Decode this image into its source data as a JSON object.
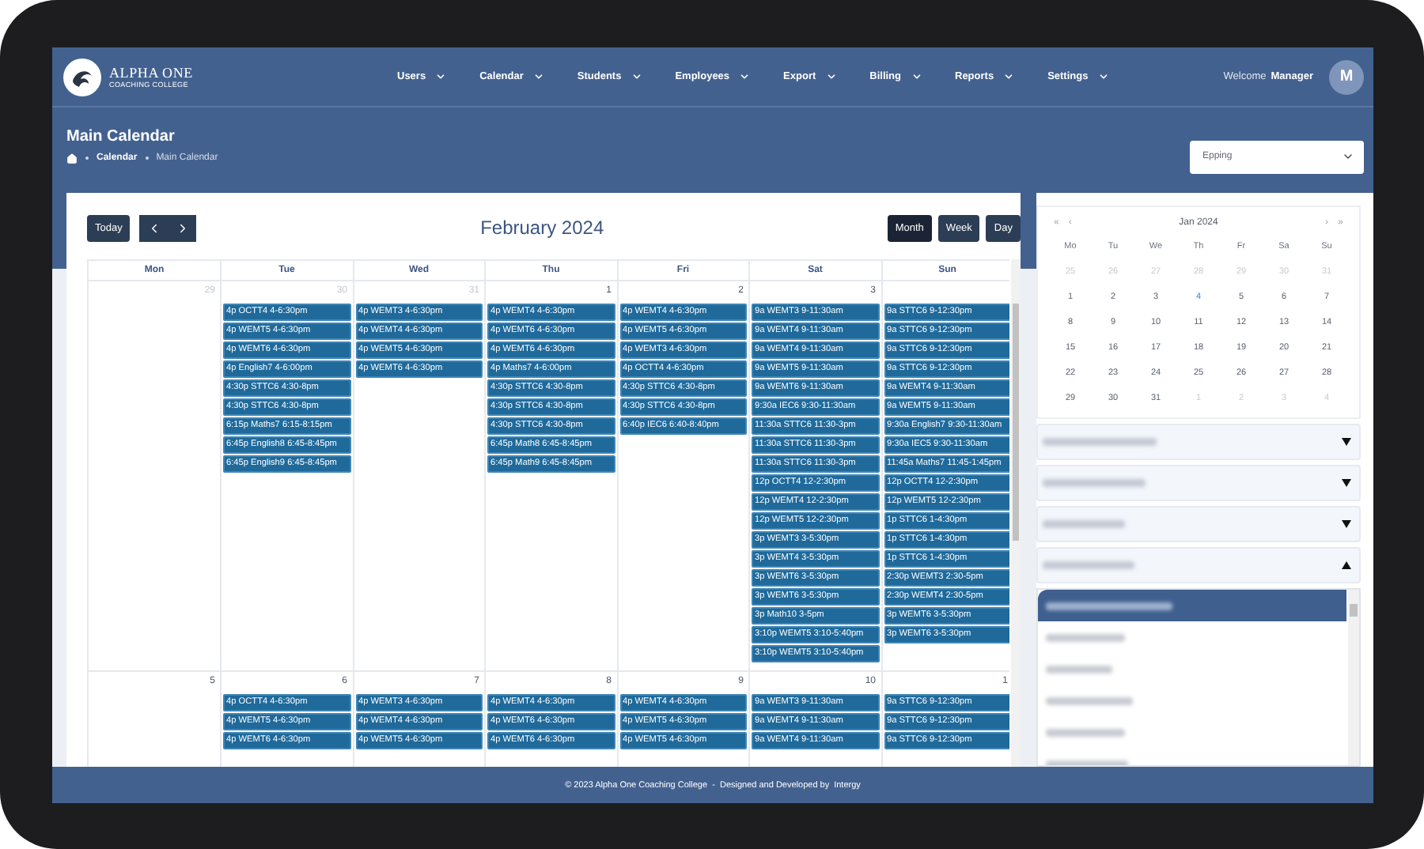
{
  "nav": {
    "logo": {
      "title": "ALPHA ONE",
      "subtitle": "COACHING COLLEGE"
    },
    "menu": [
      {
        "label": "Users"
      },
      {
        "label": "Calendar"
      },
      {
        "label": "Students"
      },
      {
        "label": "Employees"
      },
      {
        "label": "Export"
      },
      {
        "label": "Billing"
      },
      {
        "label": "Reports"
      },
      {
        "label": "Settings"
      }
    ],
    "welcome": "Welcome",
    "user": "Manager",
    "avatar": "M"
  },
  "header": {
    "title": "Main Calendar",
    "breadcrumb": [
      "Calendar",
      "Main Calendar"
    ],
    "location": "Epping"
  },
  "calendar": {
    "today": "Today",
    "title": "February 2024",
    "views": [
      {
        "label": "Month",
        "selected": true
      },
      {
        "label": "Week",
        "selected": false
      },
      {
        "label": "Day",
        "selected": false
      }
    ],
    "weekdays": [
      "Mon",
      "Tue",
      "Wed",
      "Thu",
      "Fri",
      "Sat",
      "Sun"
    ],
    "weeks": [
      {
        "days": [
          {
            "number": "29",
            "muted": true
          },
          {
            "number": "30",
            "muted": true,
            "events": [
              "4p OCTT4 4-6:30pm",
              "4p WEMT5 4-6:30pm",
              "4p WEMT6 4-6:30pm",
              "4p English7 4-6:00pm",
              "4:30p STTC6 4:30-8pm",
              "4:30p STTC6 4:30-8pm",
              "6:15p Maths7 6:15-8:15pm",
              "6:45p English8 6:45-8:45pm",
              "6:45p English9 6:45-8:45pm"
            ]
          },
          {
            "number": "31",
            "muted": true,
            "events": [
              "4p WEMT3 4-6:30pm",
              "4p WEMT4 4-6:30pm",
              "4p WEMT5 4-6:30pm",
              "4p WEMT6 4-6:30pm"
            ]
          },
          {
            "number": "1",
            "muted": false,
            "events": [
              "4p WEMT4 4-6:30pm",
              "4p WEMT6 4-6:30pm",
              "4p WEMT6 4-6:30pm",
              "4p Maths7 4-6:00pm",
              "4:30p STTC6 4:30-8pm",
              "4:30p STTC6 4:30-8pm",
              "4:30p STTC6 4:30-8pm",
              "6:45p Math8 6:45-8:45pm",
              "6:45p Math9 6:45-8:45pm"
            ]
          },
          {
            "number": "2",
            "muted": false,
            "events": [
              "4p WEMT4 4-6:30pm",
              "4p WEMT5 4-6:30pm",
              "4p WEMT3 4-6:30pm",
              "4p OCTT4 4-6:30pm",
              "4:30p STTC6 4:30-8pm",
              "4:30p STTC6 4:30-8pm",
              "6:40p IEC6 6:40-8:40pm"
            ]
          },
          {
            "number": "3",
            "muted": false,
            "events": [
              "9a WEMT3 9-11:30am",
              "9a WEMT4 9-11:30am",
              "9a WEMT4 9-11:30am",
              "9a WEMT5 9-11:30am",
              "9a WEMT6 9-11:30am",
              "9:30a IEC6 9:30-11:30am",
              "11:30a STTC6 11:30-3pm",
              "11:30a STTC6 11:30-3pm",
              "11:30a STTC6 11:30-3pm",
              "12p OCTT4 12-2:30pm",
              "12p WEMT4 12-2:30pm",
              "12p WEMT5 12-2:30pm",
              "3p WEMT3 3-5:30pm",
              "3p WEMT4 3-5:30pm",
              "3p WEMT6 3-5:30pm",
              "3p WEMT6 3-5:30pm",
              "3p Math10 3-5pm",
              "3:10p WEMT5 3:10-5:40pm",
              "3:10p WEMT5 3:10-5:40pm"
            ]
          },
          {
            "events": [
              "9a STTC6 9-12:30pm",
              "9a STTC6 9-12:30pm",
              "9a STTC6 9-12:30pm",
              "9a STTC6 9-12:30pm",
              "9a WEMT4 9-11:30am",
              "9a WEMT5 9-11:30am",
              "9:30a English7 9:30-11:30am",
              "9:30a IEC5 9:30-11:30am",
              "11:45a Maths7 11:45-1:45pm",
              "12p OCTT4 12-2:30pm",
              "12p WEMT5 12-2:30pm",
              "1p STTC6 1-4:30pm",
              "1p STTC6 1-4:30pm",
              "1p STTC6 1-4:30pm",
              "2:30p WEMT3 2:30-5pm",
              "2:30p WEMT4 2:30-5pm",
              "3p WEMT6 3-5:30pm",
              "3p WEMT6 3-5:30pm"
            ]
          }
        ]
      },
      {
        "days": [
          {
            "number": "5",
            "muted": false
          },
          {
            "number": "6",
            "muted": false,
            "events": [
              "4p OCTT4 4-6:30pm",
              "4p WEMT5 4-6:30pm",
              "4p WEMT6 4-6:30pm"
            ]
          },
          {
            "number": "7",
            "muted": false,
            "events": [
              "4p WEMT3 4-6:30pm",
              "4p WEMT4 4-6:30pm",
              "4p WEMT5 4-6:30pm"
            ]
          },
          {
            "number": "8",
            "muted": false,
            "events": [
              "4p WEMT4 4-6:30pm",
              "4p WEMT6 4-6:30pm",
              "4p WEMT6 4-6:30pm"
            ]
          },
          {
            "number": "9",
            "muted": false,
            "events": [
              "4p WEMT4 4-6:30pm",
              "4p WEMT5 4-6:30pm",
              "4p WEMT5 4-6:30pm"
            ]
          },
          {
            "number": "10",
            "muted": false,
            "events": [
              "9a WEMT3 9-11:30am",
              "9a WEMT4 9-11:30am",
              "9a WEMT4 9-11:30am"
            ]
          },
          {
            "number": "1",
            "muted": false,
            "events": [
              "9a STTC6 9-12:30pm",
              "9a STTC6 9-12:30pm",
              "9a STTC6 9-12:30pm"
            ]
          }
        ]
      }
    ]
  },
  "mini_calendar": {
    "nav_left": [
      "«",
      "‹"
    ],
    "title": "Jan  2024",
    "nav_right": [
      "›",
      "»"
    ],
    "weekdays": [
      "Mo",
      "Tu",
      "We",
      "Th",
      "Fr",
      "Sa",
      "Su"
    ],
    "weeks": [
      [
        {
          "n": "25",
          "muted": true
        },
        {
          "n": "26",
          "muted": true
        },
        {
          "n": "27",
          "muted": true
        },
        {
          "n": "28",
          "muted": true
        },
        {
          "n": "29",
          "muted": true
        },
        {
          "n": "30",
          "muted": true
        },
        {
          "n": "31",
          "muted": true
        }
      ],
      [
        {
          "n": "1"
        },
        {
          "n": "2"
        },
        {
          "n": "3"
        },
        {
          "n": "4",
          "today": true
        },
        {
          "n": "5"
        },
        {
          "n": "6"
        },
        {
          "n": "7"
        }
      ],
      [
        {
          "n": "8"
        },
        {
          "n": "9"
        },
        {
          "n": "10"
        },
        {
          "n": "11"
        },
        {
          "n": "12"
        },
        {
          "n": "13"
        },
        {
          "n": "14"
        }
      ],
      [
        {
          "n": "15"
        },
        {
          "n": "16"
        },
        {
          "n": "17"
        },
        {
          "n": "18"
        },
        {
          "n": "19"
        },
        {
          "n": "20"
        },
        {
          "n": "21"
        }
      ],
      [
        {
          "n": "22"
        },
        {
          "n": "23"
        },
        {
          "n": "24"
        },
        {
          "n": "25"
        },
        {
          "n": "26"
        },
        {
          "n": "27"
        },
        {
          "n": "28"
        }
      ],
      [
        {
          "n": "29"
        },
        {
          "n": "30"
        },
        {
          "n": "31"
        },
        {
          "n": "1",
          "muted": true
        },
        {
          "n": "2",
          "muted": true
        },
        {
          "n": "3",
          "muted": true
        },
        {
          "n": "4",
          "muted": true
        }
      ]
    ]
  },
  "filters": [
    {
      "expanded": false
    },
    {
      "expanded": false
    },
    {
      "expanded": false
    },
    {
      "expanded": true
    }
  ],
  "filter_options": [
    {
      "selected": true
    },
    {
      "selected": false
    },
    {
      "selected": false
    },
    {
      "selected": false
    },
    {
      "selected": false
    },
    {
      "selected": false
    }
  ],
  "footer": {
    "text": "© 2023 Alpha One Coaching College  -  Designed and Developed by",
    "link": "Intergy"
  }
}
